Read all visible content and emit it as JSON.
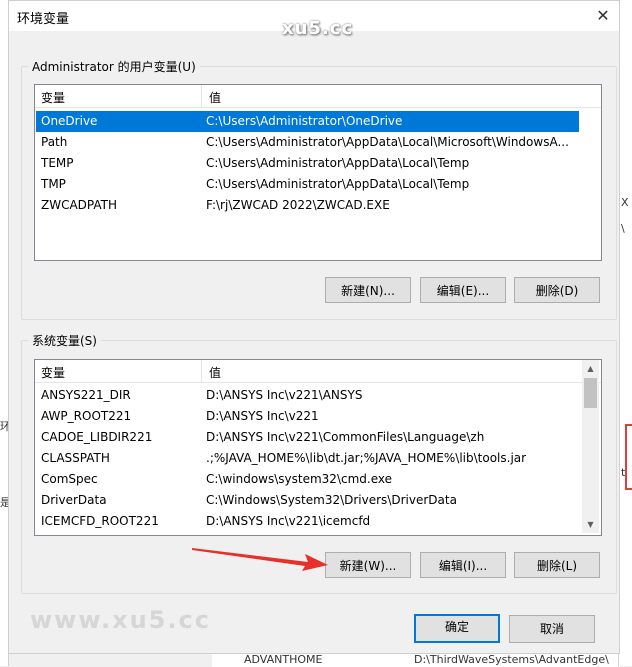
{
  "dialog": {
    "title": "环境变量",
    "close_glyph": "✕"
  },
  "watermark": {
    "top": "xu5.cc",
    "bottom": "www.xu5.cc"
  },
  "user_vars": {
    "group_label": "Administrator 的用户变量(U)",
    "col_var": "变量",
    "col_val": "值",
    "rows": [
      {
        "name": "OneDrive",
        "value": "C:\\Users\\Administrator\\OneDrive",
        "selected": true
      },
      {
        "name": "Path",
        "value": "C:\\Users\\Administrator\\AppData\\Local\\Microsoft\\WindowsA...",
        "selected": false
      },
      {
        "name": "TEMP",
        "value": "C:\\Users\\Administrator\\AppData\\Local\\Temp",
        "selected": false
      },
      {
        "name": "TMP",
        "value": "C:\\Users\\Administrator\\AppData\\Local\\Temp",
        "selected": false
      },
      {
        "name": "ZWCADPATH",
        "value": "F:\\rj\\ZWCAD 2022\\ZWCAD.EXE",
        "selected": false
      }
    ],
    "btn_new": "新建(N)...",
    "btn_edit": "编辑(E)...",
    "btn_delete": "删除(D)"
  },
  "system_vars": {
    "group_label": "系统变量(S)",
    "col_var": "变量",
    "col_val": "值",
    "rows": [
      {
        "name": "ANSYS221_DIR",
        "value": "D:\\ANSYS Inc\\v221\\ANSYS"
      },
      {
        "name": "AWP_ROOT221",
        "value": "D:\\ANSYS Inc\\v221"
      },
      {
        "name": "CADOE_LIBDIR221",
        "value": "D:\\ANSYS Inc\\v221\\CommonFiles\\Language\\zh"
      },
      {
        "name": "CLASSPATH",
        "value": ".;%JAVA_HOME%\\lib\\dt.jar;%JAVA_HOME%\\lib\\tools.jar"
      },
      {
        "name": "ComSpec",
        "value": "C:\\windows\\system32\\cmd.exe"
      },
      {
        "name": "DriverData",
        "value": "C:\\Windows\\System32\\Drivers\\DriverData"
      },
      {
        "name": "ICEMCFD_ROOT221",
        "value": "D:\\ANSYS Inc\\v221\\icemcfd"
      }
    ],
    "btn_new": "新建(W)...",
    "btn_edit": "编辑(I)...",
    "btn_delete": "删除(L)"
  },
  "footer": {
    "ok": "确定",
    "cancel": "取消"
  },
  "background": {
    "left_fragments": [
      "环",
      "是"
    ],
    "right_fragments": [
      "X",
      "\\",
      "t"
    ],
    "bottom_name": "ADVANTHOME",
    "bottom_value": "D:\\ThirdWaveSystems\\AdvantEdge\\"
  },
  "colors": {
    "selection": "#0078d7",
    "annotation_arrow": "#e8302a"
  }
}
